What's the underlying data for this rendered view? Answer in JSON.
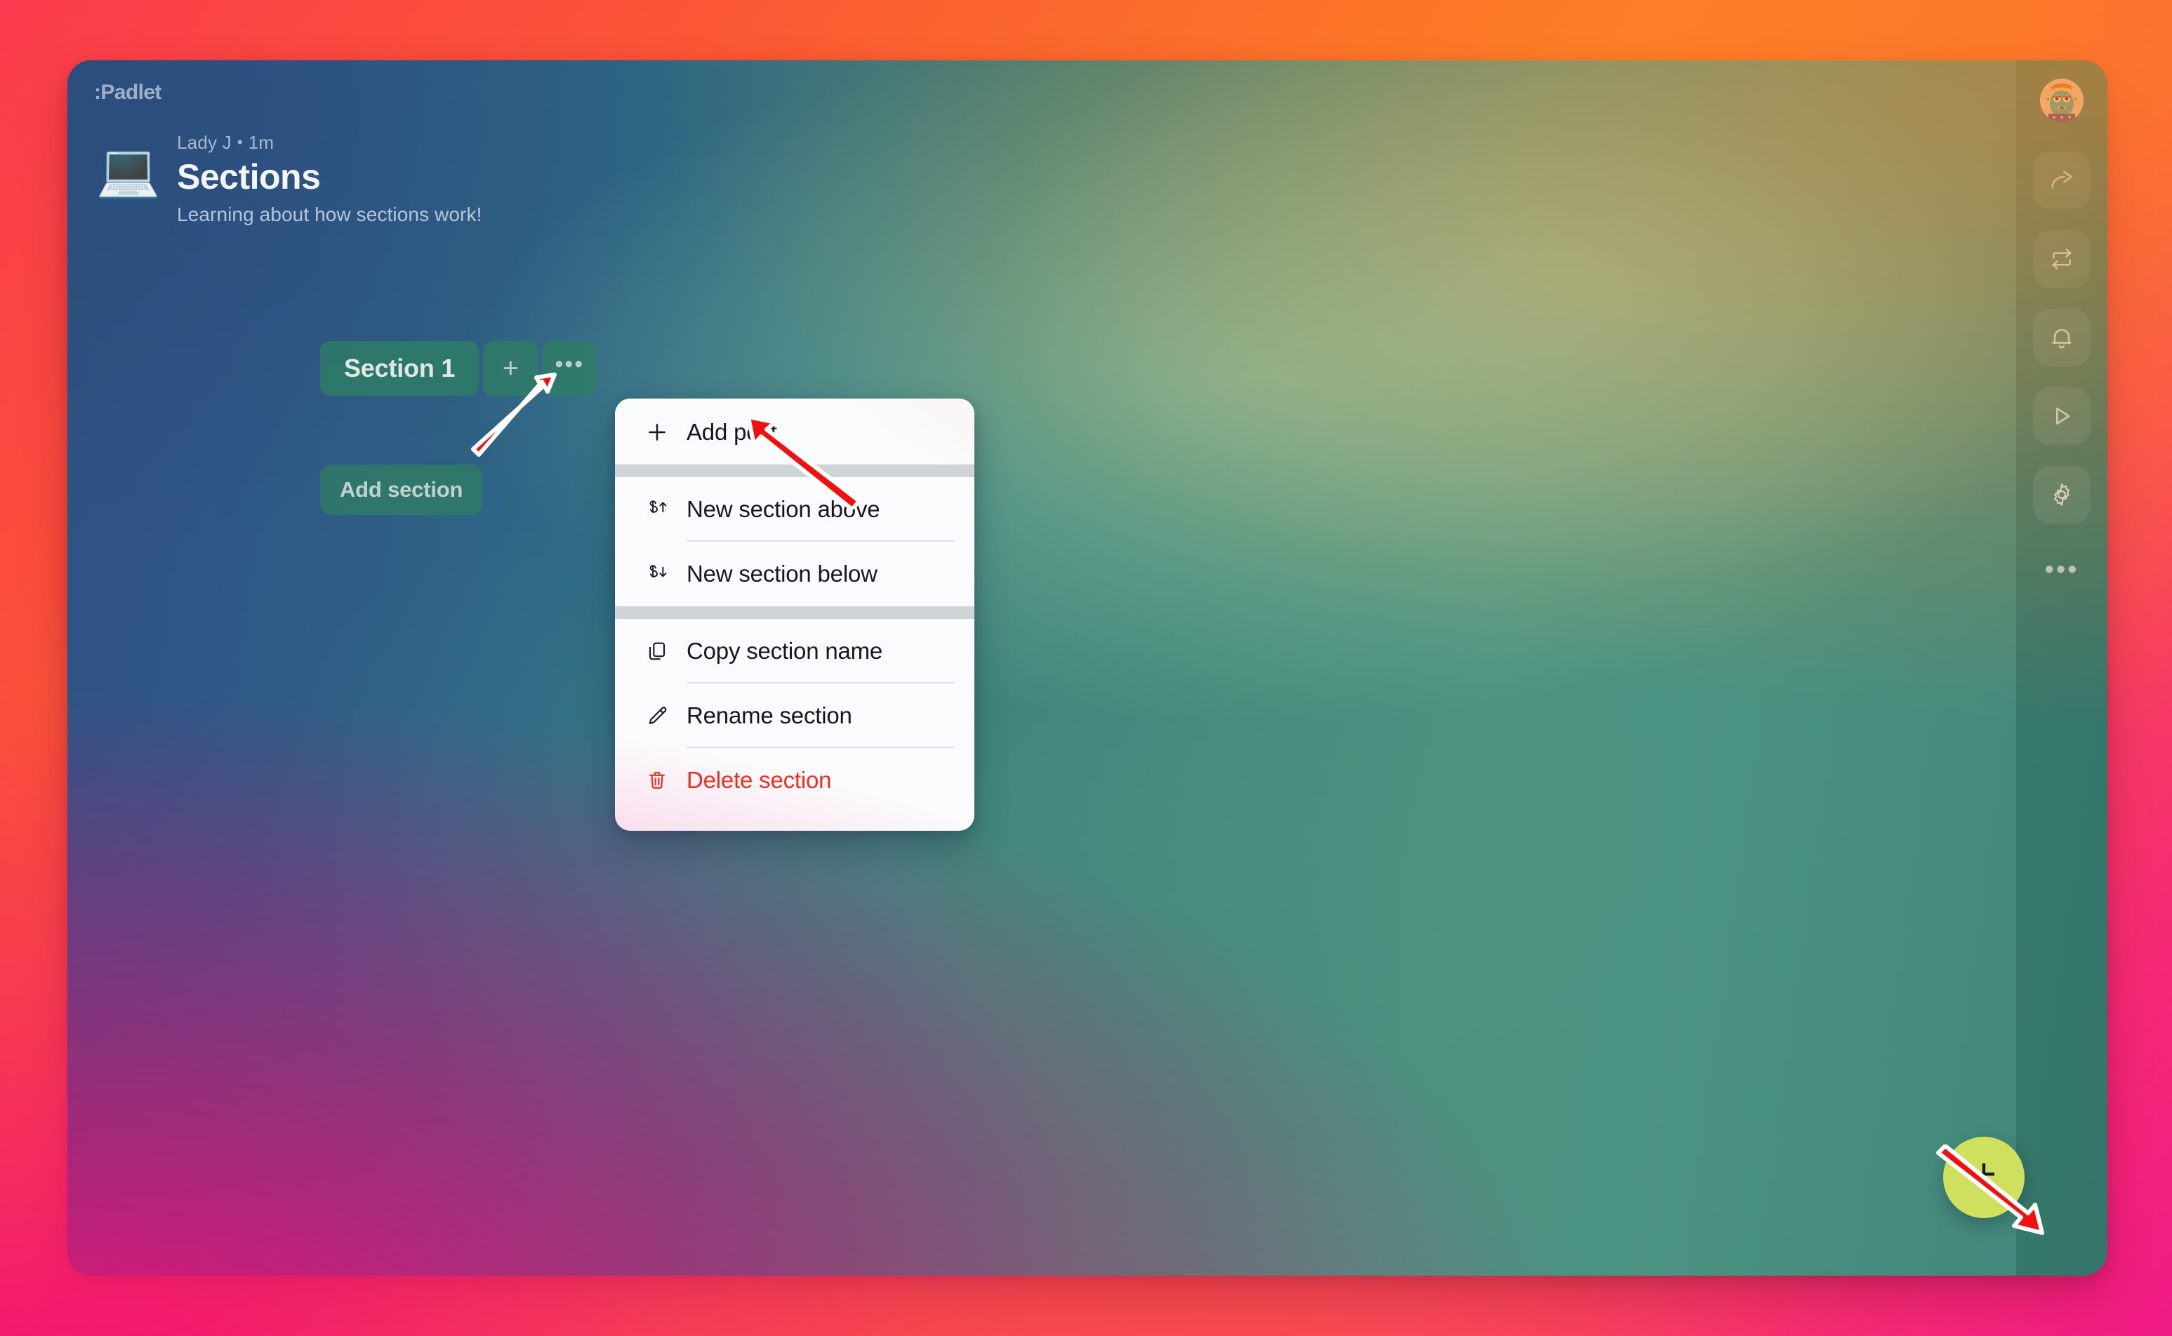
{
  "brand": {
    "name": ":Padlet"
  },
  "board": {
    "emoji": "💻",
    "emoji_name": "laptop-emoji",
    "byline_author": "Lady J",
    "byline_separator": "•",
    "byline_time": "1m",
    "title": "Sections",
    "description": "Learning about how sections work!",
    "canvas_gradient_from": "#2f5182",
    "canvas_gradient_to": "#4b9382"
  },
  "sections": {
    "tabs": [
      {
        "label": "Section 1",
        "kind": "section"
      },
      {
        "label": "+",
        "kind": "add"
      },
      {
        "label": "•••",
        "kind": "more"
      }
    ],
    "add_section_label": "Add section",
    "tab_color": "#2f7b68"
  },
  "context_menu": {
    "groups": [
      {
        "items": [
          {
            "label": "Add post",
            "icon": "plus-icon",
            "danger": false,
            "rule": false
          }
        ]
      },
      {
        "items": [
          {
            "label": "New section above",
            "icon": "section-up-icon",
            "danger": false,
            "rule": true
          },
          {
            "label": "New section below",
            "icon": "section-down-icon",
            "danger": false,
            "rule": false
          }
        ]
      },
      {
        "items": [
          {
            "label": "Copy section name",
            "icon": "copy-icon",
            "danger": false,
            "rule": true
          },
          {
            "label": "Rename section",
            "icon": "pencil-icon",
            "danger": false,
            "rule": true
          },
          {
            "label": "Delete section",
            "icon": "trash-icon",
            "danger": true,
            "rule": false
          }
        ]
      }
    ],
    "danger_color": "#ee2c1f",
    "background": "#fafbfc"
  },
  "right_rail": {
    "avatar_name": "user-avatar",
    "buttons": [
      {
        "icon": "share-icon",
        "name": "share-button"
      },
      {
        "icon": "remake-icon",
        "name": "remake-button"
      },
      {
        "icon": "bell-icon",
        "name": "notifications-button"
      },
      {
        "icon": "play-icon",
        "name": "slideshow-button"
      },
      {
        "icon": "gear-icon",
        "name": "settings-button"
      }
    ],
    "more_label": "•••"
  },
  "fab": {
    "label": "+",
    "color": "#cfe05e"
  },
  "annotations": {
    "arrow_color": "#f2100e",
    "arrows": [
      {
        "name": "arrow-to-add-section-tab",
        "points_to": "add-section-tab-button"
      },
      {
        "name": "arrow-to-add-post",
        "points_to": "menu-item-add-post"
      },
      {
        "name": "arrow-to-fab",
        "points_to": "floating-add-post-button"
      }
    ]
  }
}
